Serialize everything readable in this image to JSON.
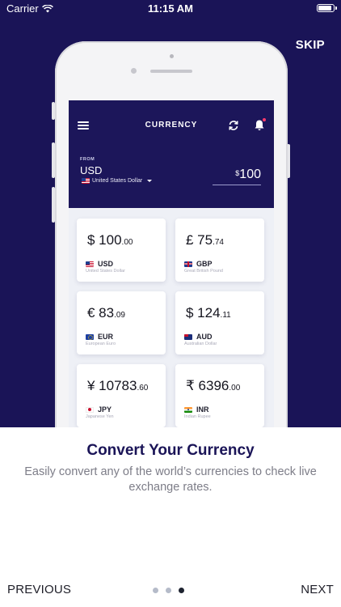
{
  "status_bar": {
    "carrier": "Carrier",
    "time": "11:15 AM",
    "battery_level": 1.0
  },
  "skip_label": "SKIP",
  "app": {
    "title": "CURRENCY",
    "from_label": "FROM",
    "from_code": "USD",
    "from_name": "United States Dollar",
    "amount_symbol": "$",
    "amount_value": "100",
    "cards": [
      {
        "symbol_whole": "$ 100",
        "decimal": ".00",
        "code": "USD",
        "name": "United States Dollar",
        "flag": "us-flag"
      },
      {
        "symbol_whole": "£ 75",
        "decimal": ".74",
        "code": "GBP",
        "name": "Great British Pound",
        "flag": "gb-flag"
      },
      {
        "symbol_whole": "€ 83",
        "decimal": ".09",
        "code": "EUR",
        "name": "European Euro",
        "flag": "eu-flag"
      },
      {
        "symbol_whole": "$ 124",
        "decimal": ".11",
        "code": "AUD",
        "name": "Australian Dollar",
        "flag": "au-flag"
      },
      {
        "symbol_whole": "¥ 10783",
        "decimal": ".60",
        "code": "JPY",
        "name": "Japanese Yen",
        "flag": "jp-flag"
      },
      {
        "symbol_whole": "₹ 6396",
        "decimal": ".00",
        "code": "INR",
        "name": "Indian Rupee",
        "flag": "in-flag"
      }
    ]
  },
  "onboarding": {
    "headline": "Convert Your Currency",
    "body": "Easily convert any of the world’s currencies to check live exchange rates.",
    "previous_label": "PREVIOUS",
    "next_label": "NEXT",
    "page_count": 3,
    "current_page": 3
  },
  "colors": {
    "navy": "#1a1457",
    "header_navy": "#1c165a",
    "dot_inactive": "#b5bbc9",
    "dot_active": "#1e2330"
  }
}
